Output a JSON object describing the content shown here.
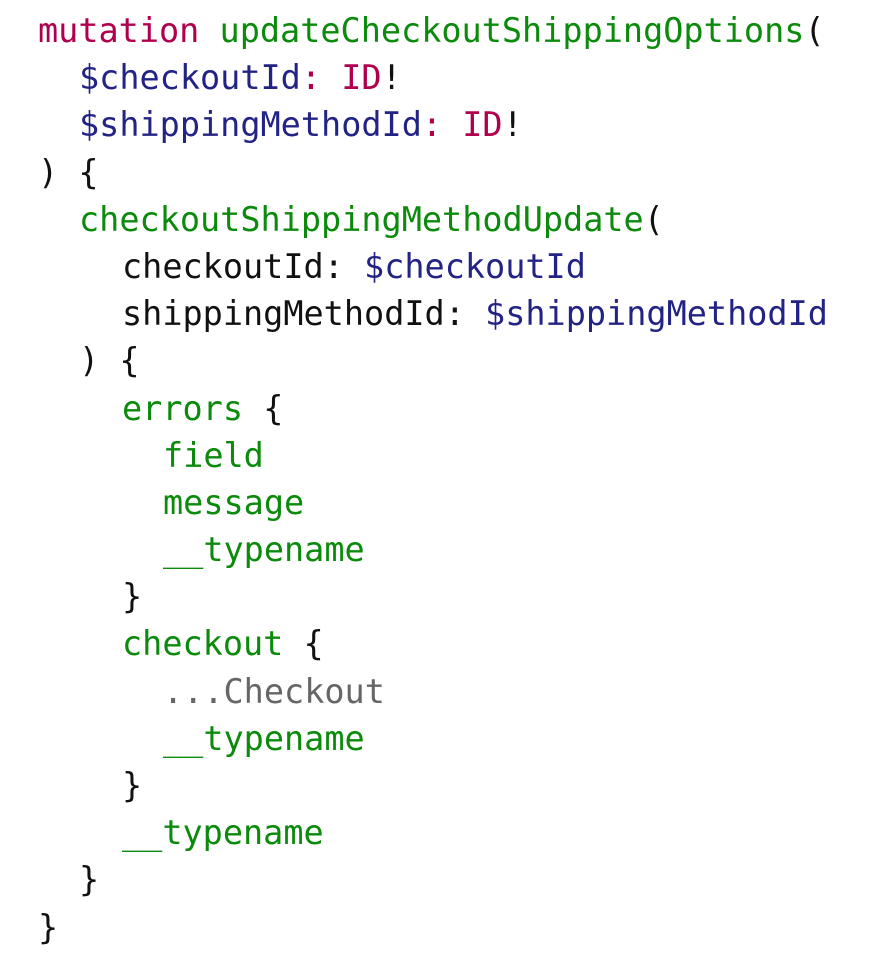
{
  "code": {
    "mutation_keyword": "mutation",
    "operation_name": "updateCheckoutShippingOptions",
    "open_paren": "(",
    "var_checkout": "$checkoutId",
    "var_checkout_colon": ":",
    "var_checkout_type": "ID",
    "bang": "!",
    "var_shipping": "$shippingMethodId",
    "var_shipping_colon": ":",
    "var_shipping_type": "ID",
    "close_paren_open_brace": ") {",
    "field_update": "checkoutShippingMethodUpdate",
    "arg_checkout": "checkoutId:",
    "arg_checkout_value": "$checkoutId",
    "arg_shipping": "shippingMethodId:",
    "arg_shipping_value": "$shippingMethodId",
    "field_errors": "errors",
    "open_brace": "{",
    "close_brace": "}",
    "field_field": "field",
    "field_message": "message",
    "field_typename": "__typename",
    "field_checkout": "checkout",
    "spread_prefix": "...",
    "fragment_checkout": "Checkout"
  },
  "colors": {
    "keyword": "#b0004d",
    "field": "#0b8a0b",
    "variable": "#232385",
    "text": "#111111",
    "spread": "#666666"
  }
}
